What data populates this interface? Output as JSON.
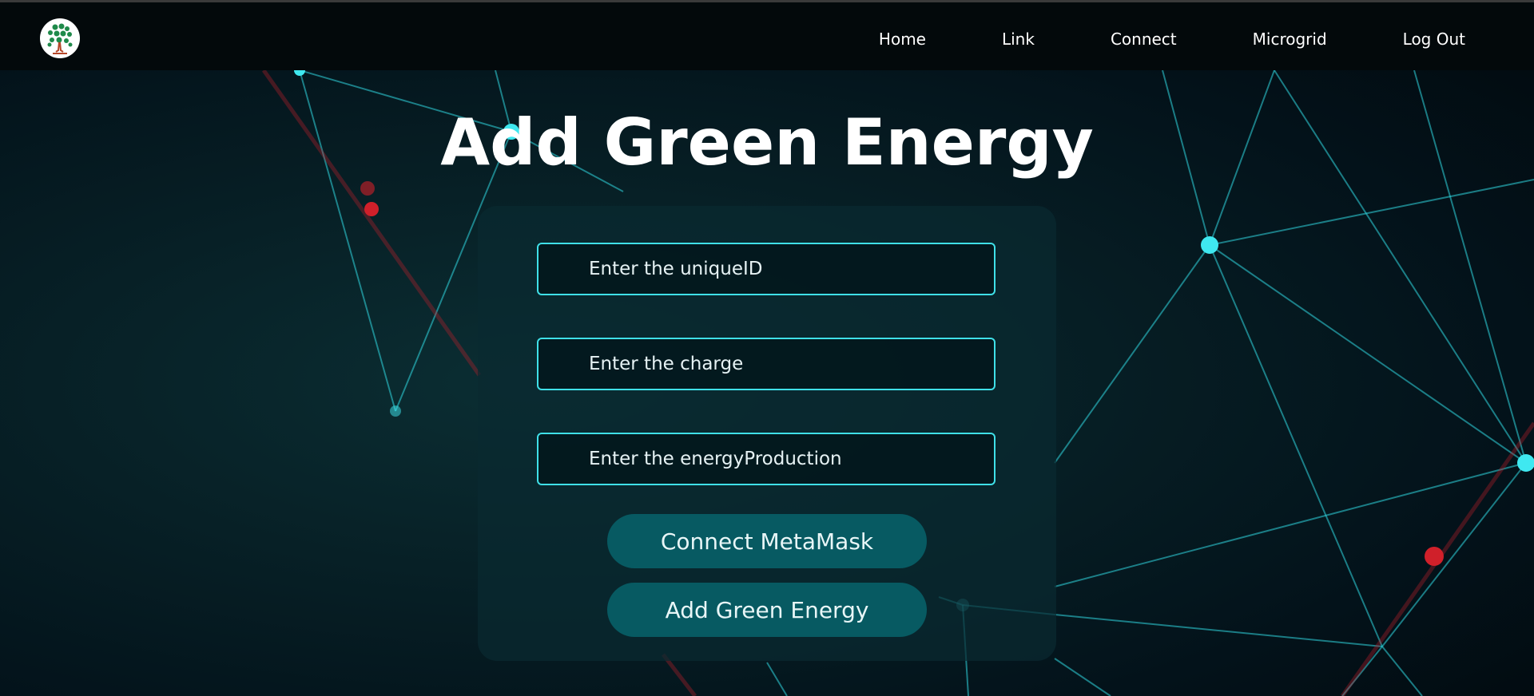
{
  "app": {
    "logo_icon": "tree-logo-icon"
  },
  "nav": {
    "items": [
      {
        "label": "Home"
      },
      {
        "label": "Link"
      },
      {
        "label": "Connect"
      },
      {
        "label": "Microgrid"
      },
      {
        "label": "Log Out"
      }
    ]
  },
  "main": {
    "title": "Add Green Energy",
    "fields": [
      {
        "placeholder": "Enter the uniqueID",
        "value": ""
      },
      {
        "placeholder": "Enter the charge",
        "value": ""
      },
      {
        "placeholder": "Enter the energyProduction",
        "value": ""
      }
    ],
    "buttons": {
      "connect_label": "Connect MetaMask",
      "add_label": "Add Green Energy"
    }
  },
  "colors": {
    "accent_cyan": "#3fe0e8",
    "button_teal": "#075a62",
    "navbar_bg": "#03090b",
    "background": "#041a1e",
    "node_red": "#c0202a"
  }
}
